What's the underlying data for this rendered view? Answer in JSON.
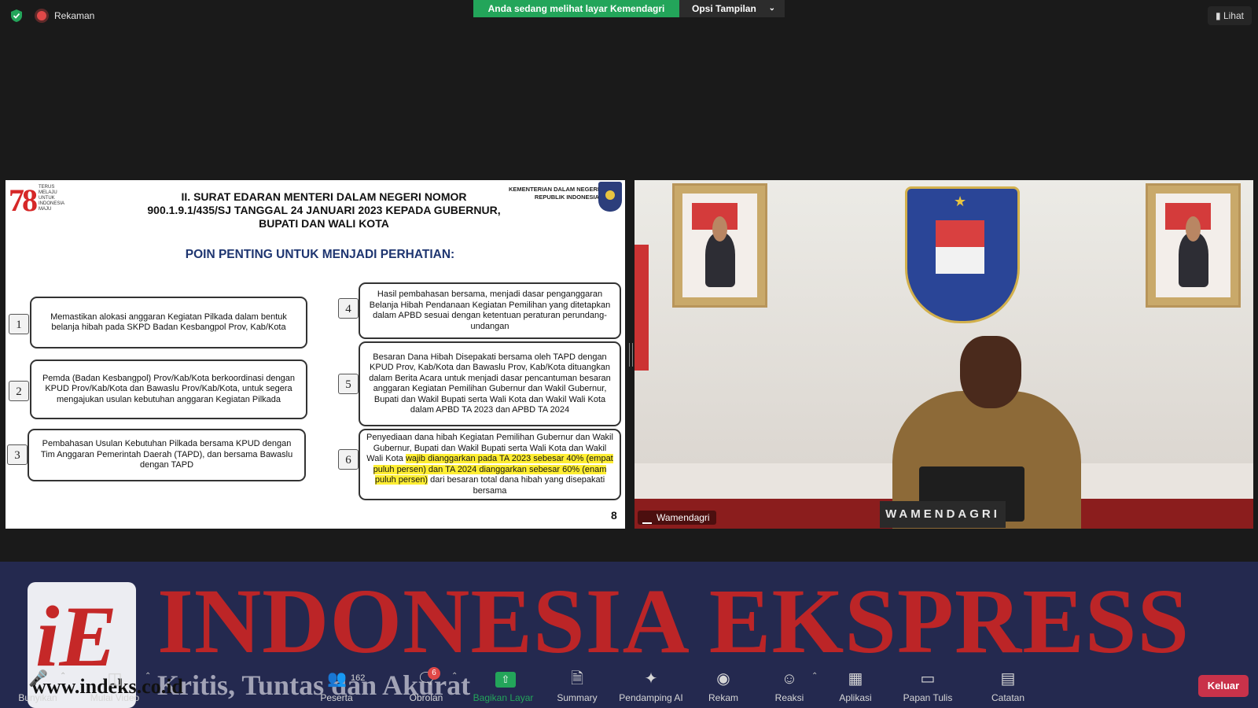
{
  "topbar": {
    "recording_label": "Rekaman",
    "share_status": "Anda sedang melihat layar Kemendagri",
    "view_options": "Opsi Tampilan",
    "view_button": "Lihat"
  },
  "slide": {
    "logo_number": "78",
    "logo_motto": "TERUS MELAJU UNTUK INDONESIA MAJU",
    "title": "II.   SURAT EDARAN MENTERI DALAM NEGERI NOMOR 900.1.9.1/435/SJ TANGGAL 24 JANUARI 2023 KEPADA GUBERNUR, BUPATI DAN WALI KOTA",
    "ministry": "KEMENTERIAN DALAM NEGERI REPUBLIK INDONESIA",
    "subtitle": "POIN PENTING UNTUK MENJADI PERHATIAN:",
    "points": [
      {
        "num": "1",
        "text": "Memastikan alokasi anggaran Kegiatan Pilkada dalam bentuk belanja hibah pada SKPD Badan Kesbangpol Prov, Kab/Kota"
      },
      {
        "num": "2",
        "text": "Pemda (Badan Kesbangpol) Prov/Kab/Kota berkoordinasi dengan KPUD Prov/Kab/Kota dan Bawaslu Prov/Kab/Kota, untuk segera mengajukan usulan kebutuhan anggaran Kegiatan Pilkada"
      },
      {
        "num": "3",
        "text": "Pembahasan Usulan Kebutuhan Pilkada bersama KPUD dengan Tim Anggaran Pemerintah Daerah (TAPD), dan bersama Bawaslu dengan TAPD"
      },
      {
        "num": "4",
        "text": "Hasil pembahasan bersama, menjadi dasar penganggaran Belanja Hibah Pendanaan Kegiatan Pemilihan yang ditetapkan dalam APBD sesuai dengan ketentuan peraturan perundang-undangan"
      },
      {
        "num": "5",
        "text": "Besaran Dana Hibah Disepakati bersama oleh TAPD dengan KPUD Prov, Kab/Kota dan Bawaslu Prov, Kab/Kota dituangkan dalam Berita Acara untuk menjadi dasar pencantuman besaran anggaran Kegiatan Pemilihan Gubernur dan Wakil Gubernur, Bupati dan Wakil Bupati serta Wali Kota dan Wakil Wali Kota dalam APBD TA 2023 dan APBD TA 2024"
      },
      {
        "num": "6",
        "text_before": "Penyediaan dana hibah Kegiatan Pemilihan Gubernur dan Wakil Gubernur, Bupati dan Wakil Bupati serta Wali Kota dan Wakil Wali Kota ",
        "text_highlight": "wajib dianggarkan pada TA 2023 sebesar 40% (empat puluh persen) dan TA 2024 dianggarkan sebesar 60% (enam puluh persen)",
        "text_after": " dari besaran total dana hibah yang disepakati bersama"
      }
    ],
    "page_number": "8"
  },
  "camera": {
    "plaque": "WAMENDAGRI",
    "participant_name": "Wamendagri"
  },
  "watermark": {
    "logo_text": "iE",
    "title": "INDONESIA EKSPRESS",
    "tagline": "Kritis, Tuntas dan Akurat",
    "url": "www.indeks.co.id"
  },
  "toolbar": {
    "items": [
      {
        "label": "Bunyikan",
        "icon": "microphone-muted-icon"
      },
      {
        "label": "Mulai Video",
        "icon": "video-off-icon"
      },
      {
        "label": "Peserta",
        "icon": "participants-icon",
        "count": "162"
      },
      {
        "label": "Obrolan",
        "icon": "chat-icon",
        "badge": "6"
      },
      {
        "label": "Bagikan Layar",
        "icon": "share-screen-icon"
      },
      {
        "label": "Summary",
        "icon": "summary-icon"
      },
      {
        "label": "Pendamping AI",
        "icon": "ai-sparkle-icon"
      },
      {
        "label": "Rekam",
        "icon": "record-icon"
      },
      {
        "label": "Reaksi",
        "icon": "reaction-icon"
      },
      {
        "label": "Aplikasi",
        "icon": "apps-icon"
      },
      {
        "label": "Papan Tulis",
        "icon": "whiteboard-icon"
      },
      {
        "label": "Catatan",
        "icon": "notes-icon"
      }
    ],
    "leave_button": "Keluar"
  },
  "colors": {
    "share_green": "#23a55a",
    "leave_red": "#c9324a",
    "slide_title_blue": "#1e3570",
    "highlight": "#ffee33"
  }
}
